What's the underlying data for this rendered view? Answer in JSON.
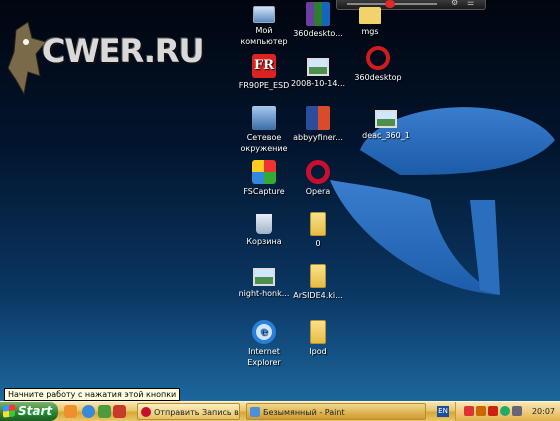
{
  "wallpaper": {
    "brand_text": "CWER.RU"
  },
  "desktop_icons": [
    {
      "label": "Мой компьютер"
    },
    {
      "label": "360deskto..."
    },
    {
      "label": "mgs"
    },
    {
      "label": "FR90PE_ESD"
    },
    {
      "label": "2008-10-14..."
    },
    {
      "label": "360desktop"
    },
    {
      "label": "Сетевое окружение"
    },
    {
      "label": "abbyyfiner..."
    },
    {
      "label": "deac_360_1"
    },
    {
      "label": "FSCapture"
    },
    {
      "label": "Opera"
    },
    {
      "label": "Корзина"
    },
    {
      "label": "0"
    },
    {
      "label": "night-honk..."
    },
    {
      "label": "ArSIDE4.ki..."
    },
    {
      "label": "Internet Explorer"
    },
    {
      "label": "Ipod"
    }
  ],
  "tooltip": {
    "text": "Начните работу с нажатия этой кнопки"
  },
  "taskbar": {
    "start_label": "Start",
    "tasks": [
      {
        "label": "Отправить Запись в ..."
      },
      {
        "label": "Безымянный - Paint"
      }
    ],
    "language": "EN",
    "clock": "20:07"
  }
}
